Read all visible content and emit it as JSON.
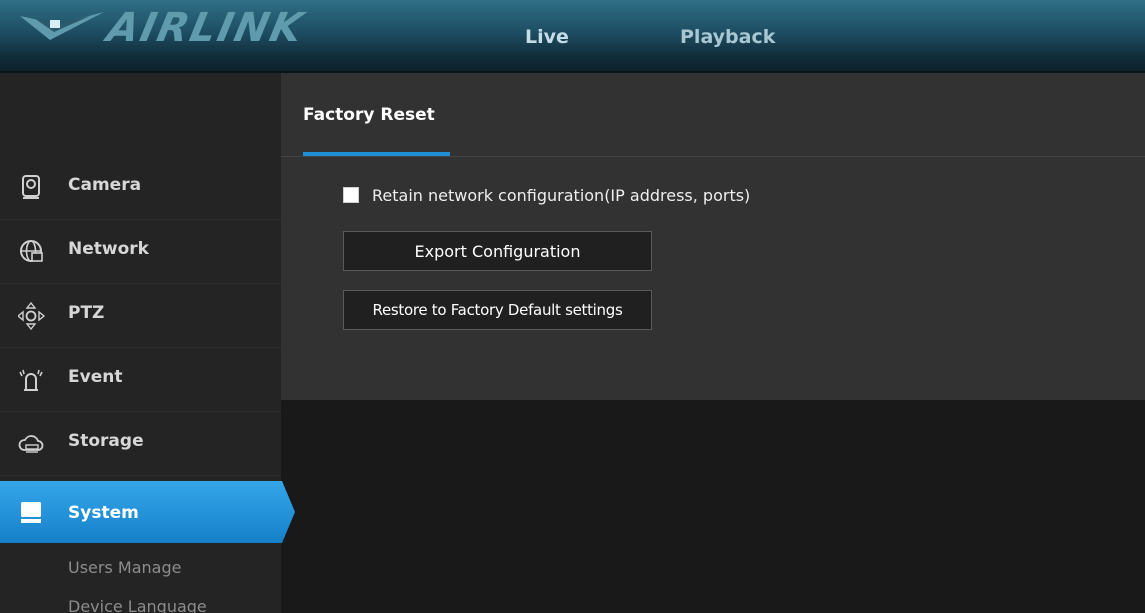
{
  "header": {
    "logo_text": "AIRLINK",
    "tabs": {
      "live": "Live",
      "playback": "Playback"
    }
  },
  "sidebar": {
    "items": [
      {
        "label": "Camera",
        "icon": "camera-icon"
      },
      {
        "label": "Network",
        "icon": "globe-network-icon"
      },
      {
        "label": "PTZ",
        "icon": "ptz-arrows-icon"
      },
      {
        "label": "Event",
        "icon": "alarm-icon"
      },
      {
        "label": "Storage",
        "icon": "cloud-storage-icon"
      },
      {
        "label": "System",
        "icon": "monitor-icon",
        "active": true
      }
    ],
    "sub_items": [
      "Users Manage",
      "Device Language"
    ]
  },
  "panel": {
    "tab_label": "Factory Reset",
    "retain_label": "Retain network configuration(IP address, ports)",
    "retain_checked": false,
    "export_button": "Export Configuration",
    "restore_button": "Restore to Factory Default settings"
  },
  "colors": {
    "accent": "#1f8fd6",
    "active_item": "#1a8fd8",
    "header_top": "#2f6f86",
    "sidebar_bg": "#242424",
    "panel_bg": "#323232",
    "page_bg": "#191919"
  }
}
